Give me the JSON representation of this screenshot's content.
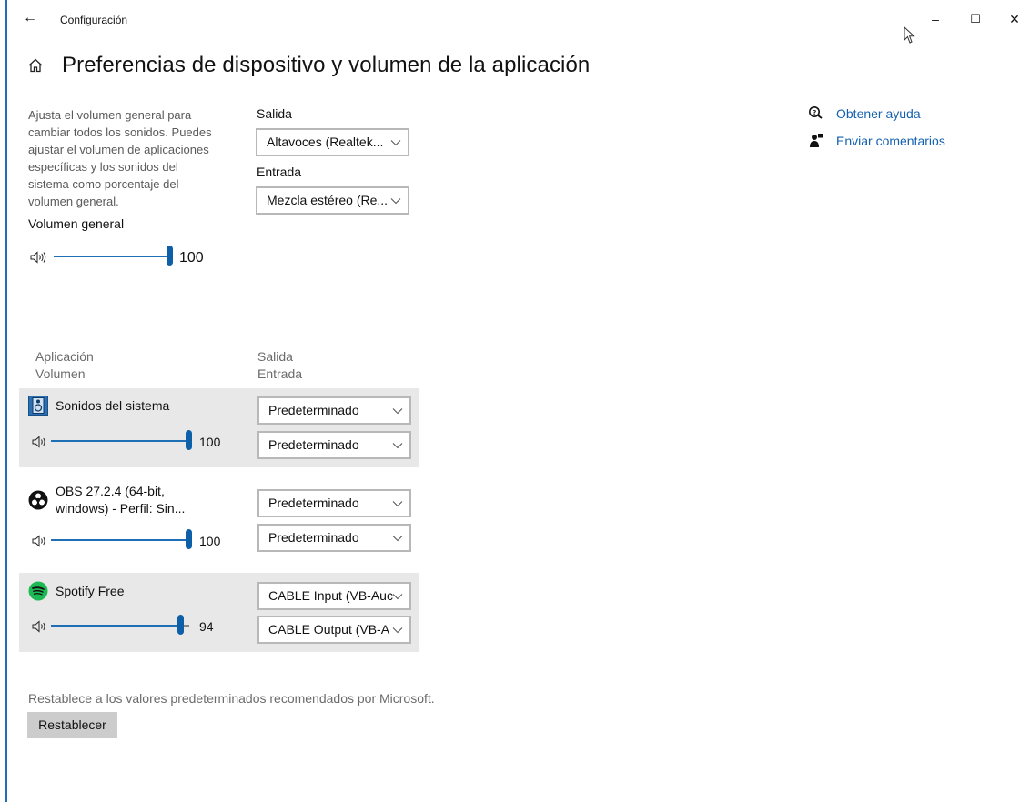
{
  "window": {
    "title": "Configuración",
    "minimize_glyph": "–",
    "maximize_glyph": "☐",
    "close_glyph": "✕",
    "back_glyph": "←"
  },
  "page": {
    "title": "Preferencias de dispositivo y volumen de la aplicación",
    "description": "Ajusta el volumen general para cambiar todos los sonidos. Puedes ajustar el volumen de aplicaciones específicas y los sonidos del sistema como porcentaje del volumen general."
  },
  "master": {
    "label": "Volumen general",
    "value": "100",
    "level": 1.0
  },
  "output": {
    "label": "Salida",
    "selected": "Altavoces (Realtek..."
  },
  "input": {
    "label": "Entrada",
    "selected": "Mezcla estéreo (Re..."
  },
  "help": {
    "get_help": "Obtener ayuda",
    "feedback": "Enviar comentarios"
  },
  "columns": {
    "app": "Aplicación",
    "volume": "Volumen",
    "output": "Salida",
    "input": "Entrada"
  },
  "apps": [
    {
      "name": "Sonidos del sistema",
      "volume": "100",
      "level": 1.0,
      "output": "Predeterminado",
      "input": "Predeterminado",
      "icon": "system-sounds-icon"
    },
    {
      "name_line1": "OBS 27.2.4 (64-bit,",
      "name_line2": "windows) - Perfil: Sin...",
      "volume": "100",
      "level": 1.0,
      "output": "Predeterminado",
      "input": "Predeterminado",
      "icon": "obs-icon"
    },
    {
      "name": "Spotify Free",
      "volume": "94",
      "level": 0.94,
      "output": "CABLE Input (VB-Auc",
      "input": "CABLE Output (VB-A",
      "icon": "spotify-icon"
    }
  ],
  "reset": {
    "description": "Restablece a los valores predeterminados recomendados por Microsoft.",
    "button": "Restablecer"
  },
  "colors": {
    "accent": "#1f6fb6",
    "link": "#1460b0",
    "panel": "#e8e8e8",
    "spotify": "#1db954"
  }
}
